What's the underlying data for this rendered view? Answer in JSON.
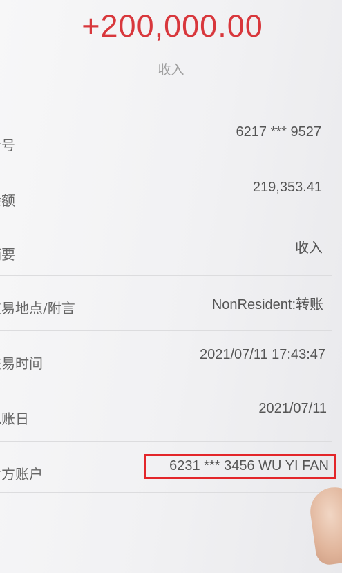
{
  "transaction": {
    "amount": "+200,000.00",
    "type_label": "收入"
  },
  "details": [
    {
      "label": "卡号",
      "value": "6217 *** 9527"
    },
    {
      "label": "余额",
      "value": "219,353.41"
    },
    {
      "label": "摘要",
      "value": "收入"
    },
    {
      "label": "交易地点/附言",
      "value": "NonResident:转账"
    },
    {
      "label": "交易时间",
      "value": "2021/07/11 17:43:47"
    },
    {
      "label": "记账日",
      "value": "2021/07/11"
    },
    {
      "label": "对方账户",
      "value": "6231 *** 3456 WU YI FAN"
    }
  ],
  "colors": {
    "amount": "#d8373c",
    "highlight_box": "#e3262a"
  }
}
